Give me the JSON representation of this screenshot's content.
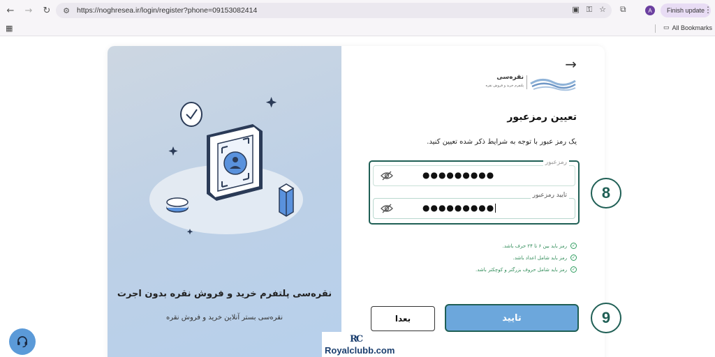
{
  "browser": {
    "url": "https://noghresea.ir/login/register?phone=09153082414",
    "avatar_letter": "A",
    "finish_update_label": "Finish update",
    "all_bookmarks_label": "All Bookmarks"
  },
  "promo": {
    "title": "نقره‌سی پلتفرم خرید و فروش نقره بدون اجرت",
    "subtitle": "نقره‌سی بستر آنلاین خرید و فروش نقره"
  },
  "logo": {
    "brand": "نقره‌سی",
    "tagline": "پلتفرم خرید و فروش نقره"
  },
  "form": {
    "title": "تعیین رمزعبور",
    "instruction": "یک رمز عبور با توجه به شرایط ذکر شده تعیین کنید.",
    "password_label": "رمزعبور",
    "password_value": "●●●●●●●●●",
    "confirm_label": "تایید رمزعبور",
    "confirm_value": "●●●●●●●●●",
    "rules": [
      "رمز باید بین ۶ تا ۲۴ حرف باشد.",
      "رمز باید شامل اعداد باشد.",
      "رمز باید شامل حروف بزرگتر و کوچکتر باشد."
    ],
    "confirm_button": "تایید",
    "later_button": "بعدا"
  },
  "annotations": {
    "step_fields": "8",
    "step_button": "9"
  },
  "watermark": {
    "mark": "RC",
    "text": "Royalclubb.com"
  },
  "colors": {
    "accent_dark": "#1f5f55",
    "primary_button": "#6ca7dc",
    "rule_green": "#2e8b57",
    "brand_blue": "#1a3e6e"
  }
}
